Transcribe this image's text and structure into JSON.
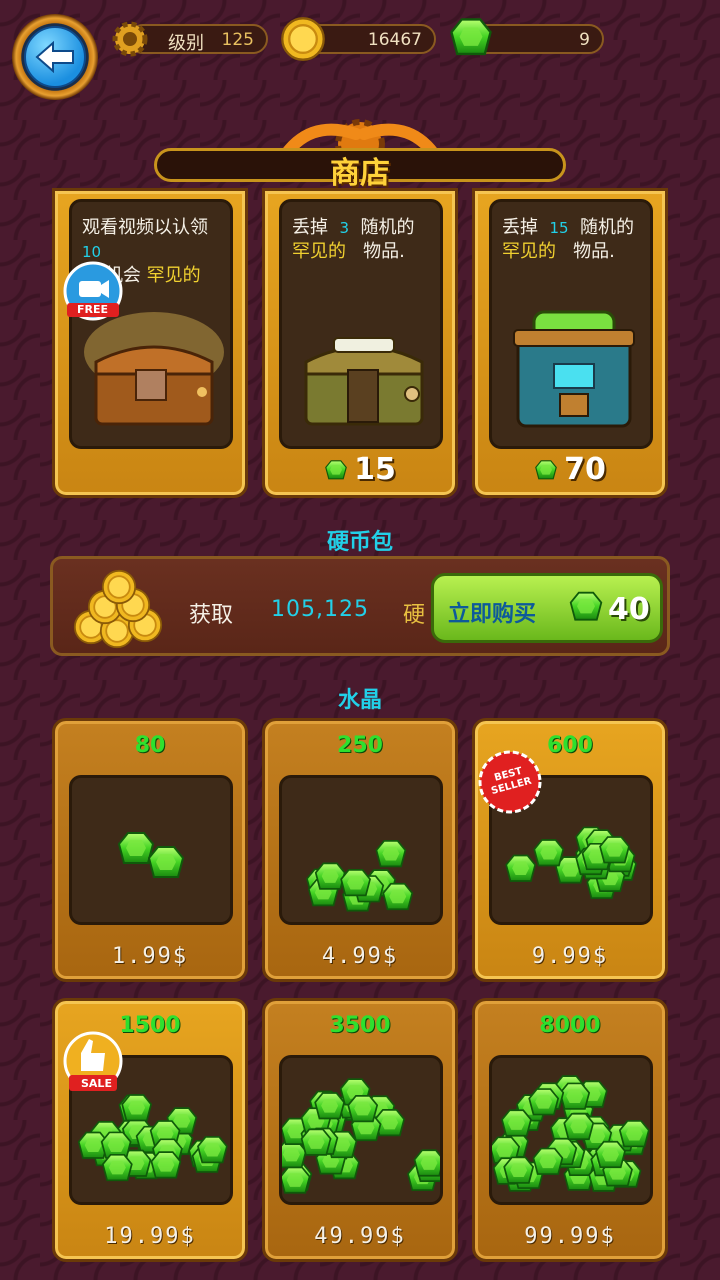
{
  "topbar": {
    "level_label": "级别",
    "level_value": "125",
    "coins_value": "16467",
    "gems_value": "9"
  },
  "title": "商店",
  "chests": [
    {
      "line1": "观看视频以认领",
      "num": "10",
      "line2a": "%",
      "line2b": "机会",
      "line2c": "罕见的",
      "badge": "FREE"
    },
    {
      "line1a": "丢掉",
      "num": "3",
      "line1b": "随机的",
      "line2a": "罕见的",
      "line2b": "物品.",
      "cost": "15"
    },
    {
      "line1a": "丢掉",
      "num": "15",
      "line1b": "随机的",
      "line2a": "罕见的",
      "line2b": "物品.",
      "cost": "70"
    }
  ],
  "coin_pack": {
    "section_title": "硬币包",
    "get_label": "获取",
    "amount": "105,125",
    "unit": "硬",
    "buy_label": "立即购买",
    "cost": "40"
  },
  "crystals": {
    "section_title": "水晶",
    "items": [
      {
        "amount": "80",
        "price": "1.99$"
      },
      {
        "amount": "250",
        "price": "4.99$"
      },
      {
        "amount": "600",
        "price": "9.99$",
        "badge": "BEST SELLER"
      },
      {
        "amount": "1500",
        "price": "19.99$",
        "badge": "SALE"
      },
      {
        "amount": "3500",
        "price": "49.99$"
      },
      {
        "amount": "8000",
        "price": "99.99$"
      }
    ]
  },
  "colors": {
    "gold": "#e7a520",
    "gem_green": "#3ed83e",
    "cyan_text": "#22d0e8",
    "background": "#4a1a2e"
  }
}
